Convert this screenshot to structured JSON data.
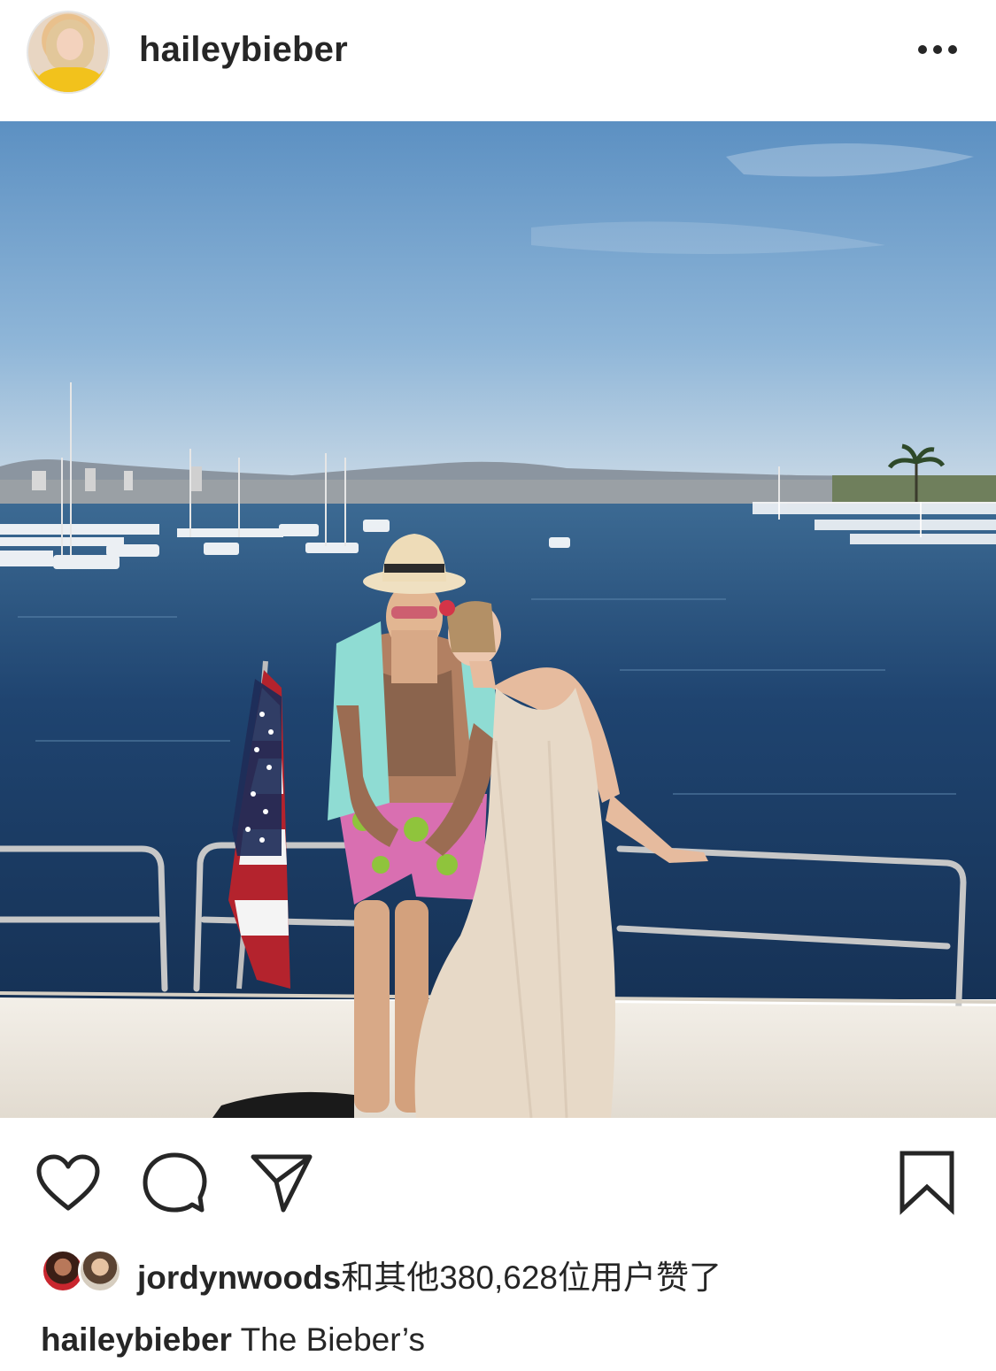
{
  "header": {
    "username": "haileybieber",
    "avatar_icon": "profile-avatar",
    "more_icon": "ellipsis-icon"
  },
  "post": {
    "image_alt_icon": "post-photo"
  },
  "actions": {
    "like_icon": "heart-icon",
    "comment_icon": "comment-bubble-icon",
    "share_icon": "paper-plane-icon",
    "save_icon": "bookmark-icon"
  },
  "likes": {
    "liker": "jordynwoods",
    "rest": "和其他380,628位用户赞了"
  },
  "caption": {
    "username": "haileybieber",
    "text": "The Bieber’s"
  },
  "colors": {
    "text": "#262626",
    "sky_top": "#5f93c4",
    "sea": "#1f3f66",
    "boat": "#f1ece4"
  }
}
